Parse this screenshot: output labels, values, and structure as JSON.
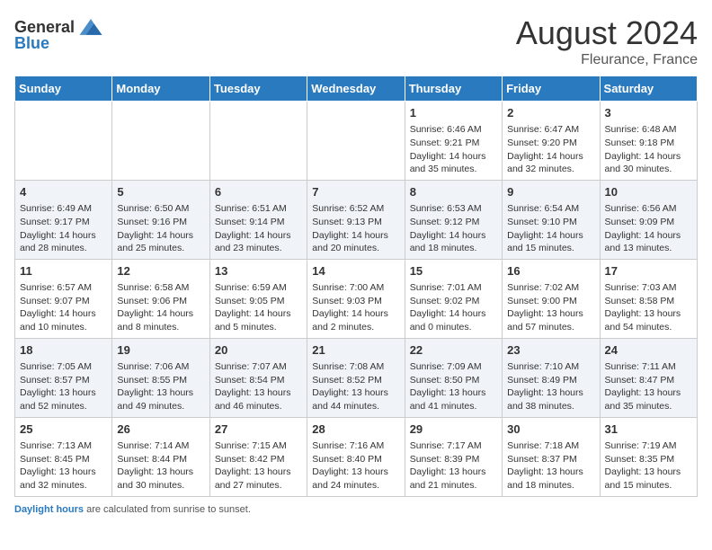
{
  "header": {
    "logo_general": "General",
    "logo_blue": "Blue",
    "month_year": "August 2024",
    "location": "Fleurance, France"
  },
  "days_of_week": [
    "Sunday",
    "Monday",
    "Tuesday",
    "Wednesday",
    "Thursday",
    "Friday",
    "Saturday"
  ],
  "weeks": [
    [
      {
        "day": "",
        "sunrise": "",
        "sunset": "",
        "daylight": ""
      },
      {
        "day": "",
        "sunrise": "",
        "sunset": "",
        "daylight": ""
      },
      {
        "day": "",
        "sunrise": "",
        "sunset": "",
        "daylight": ""
      },
      {
        "day": "",
        "sunrise": "",
        "sunset": "",
        "daylight": ""
      },
      {
        "day": "1",
        "sunrise": "Sunrise: 6:46 AM",
        "sunset": "Sunset: 9:21 PM",
        "daylight": "Daylight: 14 hours and 35 minutes."
      },
      {
        "day": "2",
        "sunrise": "Sunrise: 6:47 AM",
        "sunset": "Sunset: 9:20 PM",
        "daylight": "Daylight: 14 hours and 32 minutes."
      },
      {
        "day": "3",
        "sunrise": "Sunrise: 6:48 AM",
        "sunset": "Sunset: 9:18 PM",
        "daylight": "Daylight: 14 hours and 30 minutes."
      }
    ],
    [
      {
        "day": "4",
        "sunrise": "Sunrise: 6:49 AM",
        "sunset": "Sunset: 9:17 PM",
        "daylight": "Daylight: 14 hours and 28 minutes."
      },
      {
        "day": "5",
        "sunrise": "Sunrise: 6:50 AM",
        "sunset": "Sunset: 9:16 PM",
        "daylight": "Daylight: 14 hours and 25 minutes."
      },
      {
        "day": "6",
        "sunrise": "Sunrise: 6:51 AM",
        "sunset": "Sunset: 9:14 PM",
        "daylight": "Daylight: 14 hours and 23 minutes."
      },
      {
        "day": "7",
        "sunrise": "Sunrise: 6:52 AM",
        "sunset": "Sunset: 9:13 PM",
        "daylight": "Daylight: 14 hours and 20 minutes."
      },
      {
        "day": "8",
        "sunrise": "Sunrise: 6:53 AM",
        "sunset": "Sunset: 9:12 PM",
        "daylight": "Daylight: 14 hours and 18 minutes."
      },
      {
        "day": "9",
        "sunrise": "Sunrise: 6:54 AM",
        "sunset": "Sunset: 9:10 PM",
        "daylight": "Daylight: 14 hours and 15 minutes."
      },
      {
        "day": "10",
        "sunrise": "Sunrise: 6:56 AM",
        "sunset": "Sunset: 9:09 PM",
        "daylight": "Daylight: 14 hours and 13 minutes."
      }
    ],
    [
      {
        "day": "11",
        "sunrise": "Sunrise: 6:57 AM",
        "sunset": "Sunset: 9:07 PM",
        "daylight": "Daylight: 14 hours and 10 minutes."
      },
      {
        "day": "12",
        "sunrise": "Sunrise: 6:58 AM",
        "sunset": "Sunset: 9:06 PM",
        "daylight": "Daylight: 14 hours and 8 minutes."
      },
      {
        "day": "13",
        "sunrise": "Sunrise: 6:59 AM",
        "sunset": "Sunset: 9:05 PM",
        "daylight": "Daylight: 14 hours and 5 minutes."
      },
      {
        "day": "14",
        "sunrise": "Sunrise: 7:00 AM",
        "sunset": "Sunset: 9:03 PM",
        "daylight": "Daylight: 14 hours and 2 minutes."
      },
      {
        "day": "15",
        "sunrise": "Sunrise: 7:01 AM",
        "sunset": "Sunset: 9:02 PM",
        "daylight": "Daylight: 14 hours and 0 minutes."
      },
      {
        "day": "16",
        "sunrise": "Sunrise: 7:02 AM",
        "sunset": "Sunset: 9:00 PM",
        "daylight": "Daylight: 13 hours and 57 minutes."
      },
      {
        "day": "17",
        "sunrise": "Sunrise: 7:03 AM",
        "sunset": "Sunset: 8:58 PM",
        "daylight": "Daylight: 13 hours and 54 minutes."
      }
    ],
    [
      {
        "day": "18",
        "sunrise": "Sunrise: 7:05 AM",
        "sunset": "Sunset: 8:57 PM",
        "daylight": "Daylight: 13 hours and 52 minutes."
      },
      {
        "day": "19",
        "sunrise": "Sunrise: 7:06 AM",
        "sunset": "Sunset: 8:55 PM",
        "daylight": "Daylight: 13 hours and 49 minutes."
      },
      {
        "day": "20",
        "sunrise": "Sunrise: 7:07 AM",
        "sunset": "Sunset: 8:54 PM",
        "daylight": "Daylight: 13 hours and 46 minutes."
      },
      {
        "day": "21",
        "sunrise": "Sunrise: 7:08 AM",
        "sunset": "Sunset: 8:52 PM",
        "daylight": "Daylight: 13 hours and 44 minutes."
      },
      {
        "day": "22",
        "sunrise": "Sunrise: 7:09 AM",
        "sunset": "Sunset: 8:50 PM",
        "daylight": "Daylight: 13 hours and 41 minutes."
      },
      {
        "day": "23",
        "sunrise": "Sunrise: 7:10 AM",
        "sunset": "Sunset: 8:49 PM",
        "daylight": "Daylight: 13 hours and 38 minutes."
      },
      {
        "day": "24",
        "sunrise": "Sunrise: 7:11 AM",
        "sunset": "Sunset: 8:47 PM",
        "daylight": "Daylight: 13 hours and 35 minutes."
      }
    ],
    [
      {
        "day": "25",
        "sunrise": "Sunrise: 7:13 AM",
        "sunset": "Sunset: 8:45 PM",
        "daylight": "Daylight: 13 hours and 32 minutes."
      },
      {
        "day": "26",
        "sunrise": "Sunrise: 7:14 AM",
        "sunset": "Sunset: 8:44 PM",
        "daylight": "Daylight: 13 hours and 30 minutes."
      },
      {
        "day": "27",
        "sunrise": "Sunrise: 7:15 AM",
        "sunset": "Sunset: 8:42 PM",
        "daylight": "Daylight: 13 hours and 27 minutes."
      },
      {
        "day": "28",
        "sunrise": "Sunrise: 7:16 AM",
        "sunset": "Sunset: 8:40 PM",
        "daylight": "Daylight: 13 hours and 24 minutes."
      },
      {
        "day": "29",
        "sunrise": "Sunrise: 7:17 AM",
        "sunset": "Sunset: 8:39 PM",
        "daylight": "Daylight: 13 hours and 21 minutes."
      },
      {
        "day": "30",
        "sunrise": "Sunrise: 7:18 AM",
        "sunset": "Sunset: 8:37 PM",
        "daylight": "Daylight: 13 hours and 18 minutes."
      },
      {
        "day": "31",
        "sunrise": "Sunrise: 7:19 AM",
        "sunset": "Sunset: 8:35 PM",
        "daylight": "Daylight: 13 hours and 15 minutes."
      }
    ]
  ],
  "footer": {
    "daylight_label": "Daylight hours",
    "footer_text": " are calculated from sunrise to sunset."
  }
}
